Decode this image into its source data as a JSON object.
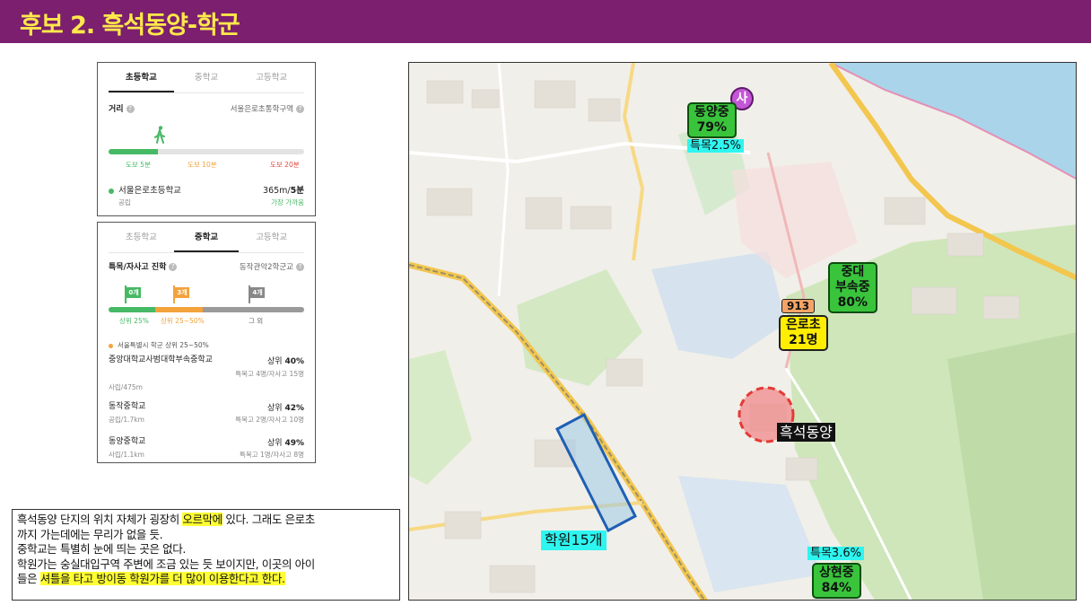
{
  "header": {
    "title": "후보 2. 흑석동양-학군"
  },
  "elementary_panel": {
    "tabs": [
      "초등학교",
      "중학교",
      "고등학교"
    ],
    "active_tab": 0,
    "distance_label": "거리",
    "district": "서울은로초통학구역",
    "walk_progress_fraction": 0.25,
    "scale_labels": [
      "도보 5분",
      "도보 10분",
      "도보 20분"
    ],
    "school_name": "서울은로초등학교",
    "school_distance_prefix": "365m/",
    "school_distance_time": "5분",
    "school_type": "공립",
    "nearest_badge": "가장 가까움",
    "colors": {
      "walk_green": "#46b964",
      "walk10_orange": "#f3a23c",
      "walk20_red": "#e0493c"
    }
  },
  "middle_panel": {
    "tabs": [
      "초등학교",
      "중학교",
      "고등학교"
    ],
    "active_tab": 1,
    "section_label": "특목/자사고 진학",
    "district": "동작관악2학군교",
    "flags": [
      {
        "count": "0개",
        "color": "#46b964"
      },
      {
        "count": "3개",
        "color": "#f3a23c"
      },
      {
        "count": "4개",
        "color": "#888888"
      }
    ],
    "segment_labels": [
      "상위 25%",
      "상위 25~50%",
      "그 외"
    ],
    "legend": "서울특별시 학군 상위 25~50%",
    "schools": [
      {
        "name": "중앙대학교사범대학부속중학교",
        "type": "사립/475m",
        "rank_prefix": "상위 ",
        "rank": "40%",
        "counts": "특목고 4명/자사고 15명"
      },
      {
        "name": "동작중학교",
        "type": "공립/1.7km",
        "rank_prefix": "상위 ",
        "rank": "42%",
        "counts": "특목고 2명/자사고 10명"
      },
      {
        "name": "동양중학교",
        "type": "사립/1.1km",
        "rank_prefix": "상위 ",
        "rank": "49%",
        "counts": "특목고 1명/자사고 8명"
      }
    ]
  },
  "caption": {
    "line1_a": "흑석동양 단지의 위치 자체가 굉장히 ",
    "line1_hl": "오르막에",
    "line1_b": " 있다. 그래도 은로초",
    "line2": "까지 가는데에는 무리가 없을 듯.",
    "line3": "중학교는 특별히 눈에 띄는 곳은 없다.",
    "line4": "학원가는 숭실대입구역 주변에 조금 있는 듯 보이지만, 이곳의 아이",
    "line5_a": "들은 ",
    "line5_hl": "셔틀을 타고 방이동 학원가를 더 많이 이용한다고 한다."
  },
  "map": {
    "labels": {
      "dongyang_mid": "동양중\n79%",
      "dongyang_special": "특목2.5%",
      "pin_letter": "사",
      "jungdae_mid": "중대\n부속중\n80%",
      "code_913": "913",
      "eunro_elem": "은로초\n21명",
      "heukseok": "흑석동양",
      "academy": "학원15개",
      "sanghyun_special": "특목3.6%",
      "sanghyun_mid": "상현중\n84%"
    },
    "colors": {
      "river": "#a9d4e9",
      "green_area": "#c9e3b5",
      "label_green": "#39c43c",
      "label_cyan": "#2ef5f0",
      "label_yellow": "#ffee00",
      "circle_red": "#e53935"
    }
  }
}
